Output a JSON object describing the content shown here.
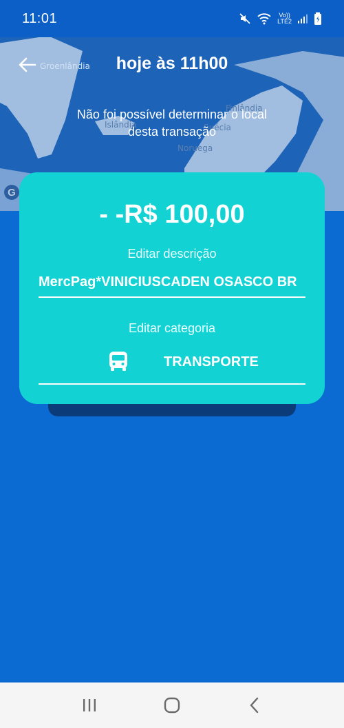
{
  "status_bar": {
    "time": "11:01",
    "network_label": "Vo))\nLTE2"
  },
  "map": {
    "labels": {
      "greenland": "Groenlândia",
      "iceland": "Islândia",
      "finland": "Finlândia",
      "sweden": "Suécia",
      "norway": "Noruega"
    },
    "attribution_glyph": "G"
  },
  "header": {
    "title": "hoje às 11h00",
    "location_message": "Não foi possível determinar o local desta transação"
  },
  "transaction": {
    "amount": "- -R$ 100,00",
    "description_label": "Editar descrição",
    "description_value": "MercPag*VINICIUSCADEN OSASCO BR",
    "category_label": "Editar categoria",
    "category_value": "TRANSPORTE",
    "category_icon": "bus-icon"
  },
  "colors": {
    "background": "#0c6bd2",
    "card": "#12d2d4",
    "map": "#1d63b8"
  }
}
